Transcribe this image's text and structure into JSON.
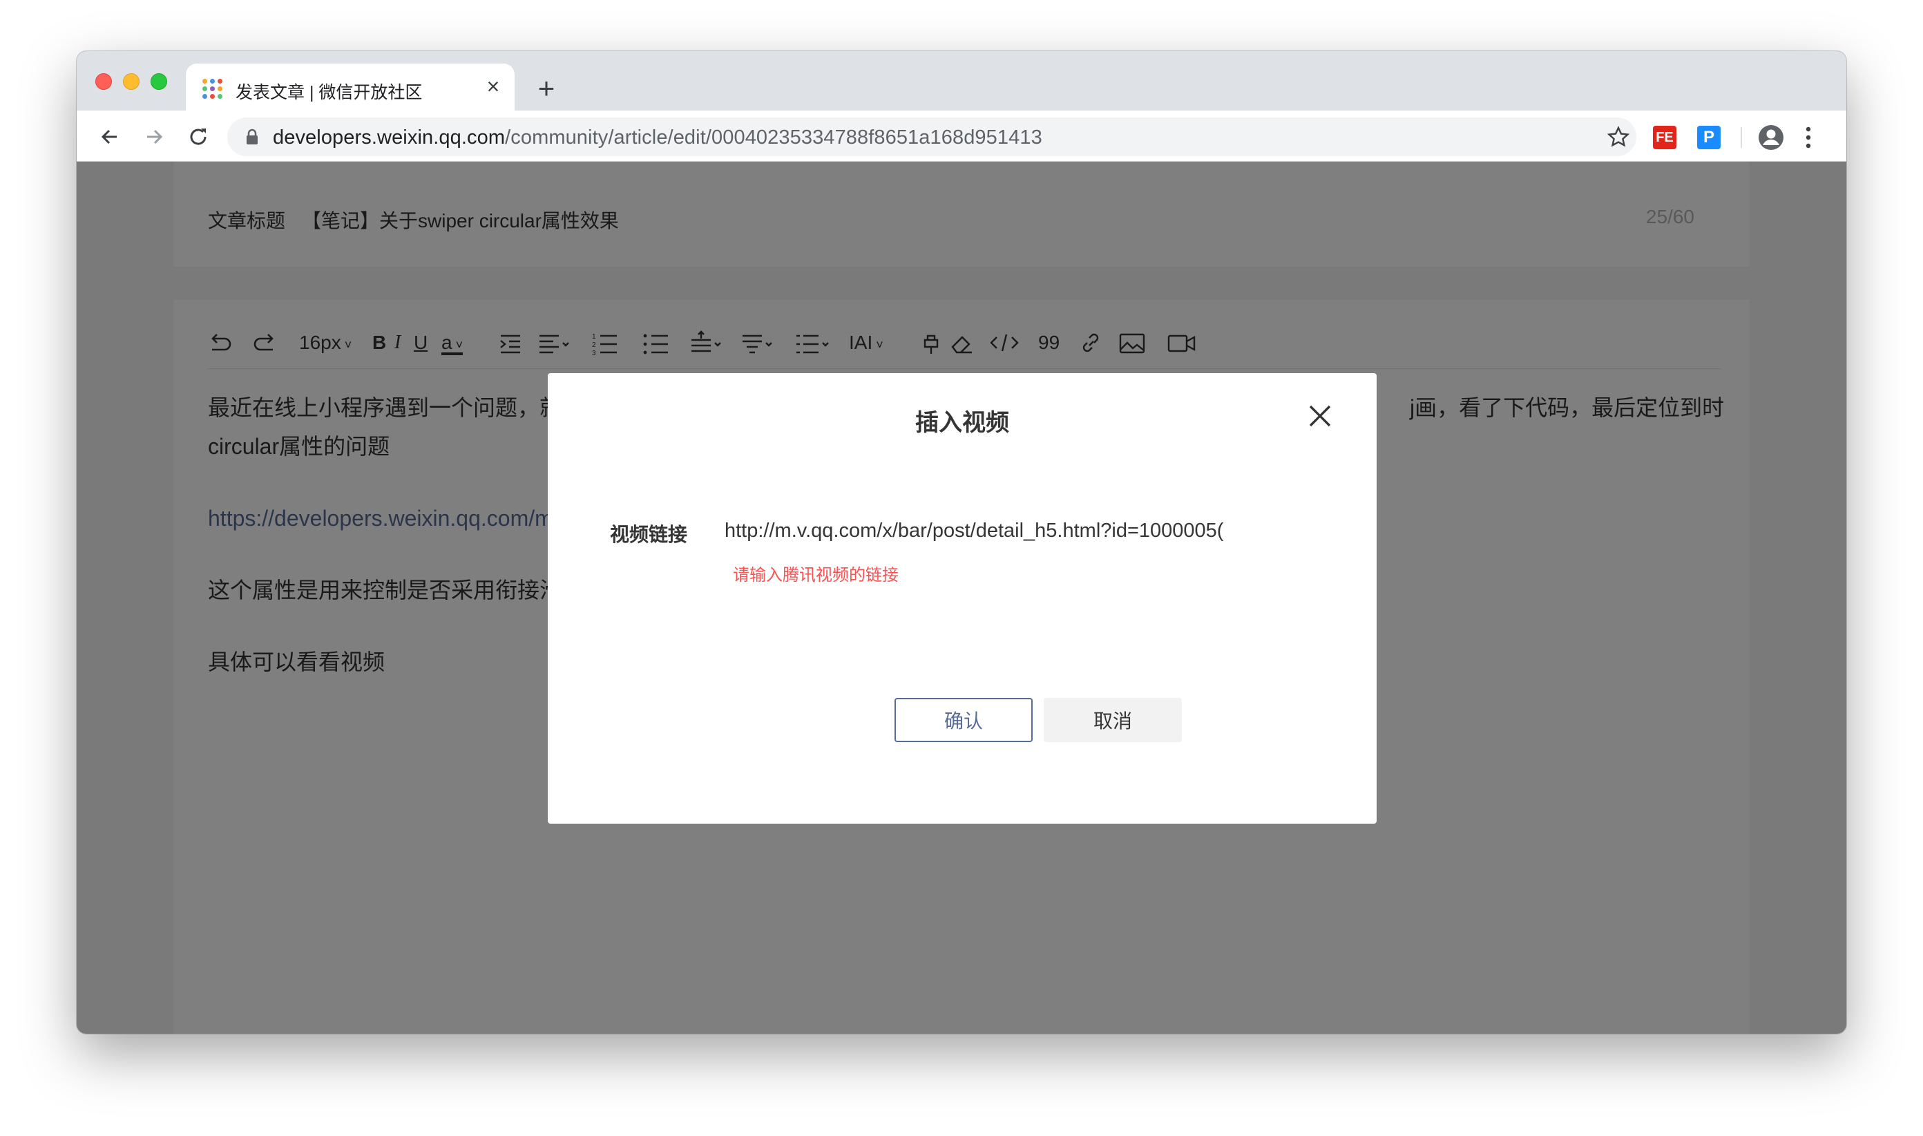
{
  "browser": {
    "tab_title": "发表文章 | 微信开放社区",
    "tab_close_glyph": "×",
    "new_tab_glyph": "+",
    "url_host": "developers.weixin.qq.com",
    "url_path": "/community/article/edit/00040235334788f8651a168d951413",
    "extensions": [
      "FE",
      "P"
    ]
  },
  "article": {
    "title_label": "文章标题",
    "title_value": "【笔记】关于swiper circular属性效果",
    "title_count": "25/60"
  },
  "editor_toolbar": {
    "font_size": "16px",
    "bold": "B",
    "italic": "I",
    "underline": "U",
    "font_color": "a",
    "letter_spacing": "IAI",
    "quote": "99",
    "items": [
      "undo-icon",
      "redo-icon",
      "font-size-select",
      "bold-icon",
      "italic-icon",
      "underline-icon",
      "font-color-icon",
      "indent-icon",
      "align-icon",
      "ordered-list-icon",
      "unordered-list-icon",
      "line-height-icon",
      "paragraph-spacing-icon",
      "list-style-icon",
      "letter-spacing-icon",
      "format-painter-icon",
      "eraser-icon",
      "code-icon",
      "quote-icon",
      "link-icon",
      "image-icon",
      "video-icon"
    ]
  },
  "editor_body": {
    "para1_left": "最近在线上小程序遇到一个问题，就",
    "para1_right": "j画，看了下代码，最后定位到时",
    "para1_line2": "circular属性的问题",
    "link": "https://developers.weixin.qq.com/m",
    "para3": "这个属性是用来控制是否采用衔接滑",
    "para4": "具体可以看看视频"
  },
  "modal": {
    "title": "插入视频",
    "field_label": "视频链接",
    "field_value": "http://m.v.qq.com/x/bar/post/detail_h5.html?id=1000005(",
    "error": "请输入腾讯视频的链接",
    "confirm": "确认",
    "cancel": "取消"
  },
  "colors": {
    "accent": "#576b95",
    "error": "#fa5151",
    "overlay": "rgba(0,0,0,0.5)"
  }
}
